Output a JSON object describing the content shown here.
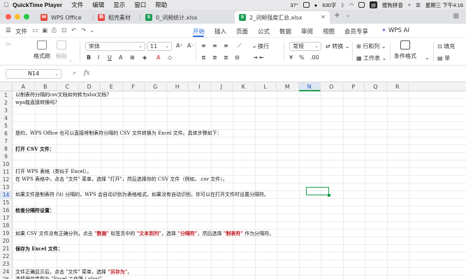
{
  "menubar": {
    "app": "QuickTime Player",
    "items": [
      "文件",
      "编辑",
      "显示",
      "窗口",
      "帮助"
    ],
    "right": {
      "temp": "37°",
      "percent": "630字",
      "ime": "搜狗拼音",
      "datetime": "星期三 下午4:16"
    }
  },
  "tabs": [
    {
      "label": "WPS Office",
      "icon": "wps-logo-icon",
      "color": "#e04b3c"
    },
    {
      "label": "稻壳素材",
      "icon": "docer-icon",
      "color": "#e8433a"
    },
    {
      "label": "0_词频统计.xlsx",
      "icon": "sheet-icon",
      "color": "#1e9e57"
    },
    {
      "label": "2_词频强度汇总.xlsx",
      "icon": "sheet-icon",
      "color": "#1e9e57"
    }
  ],
  "ribbon": {
    "file": "文件",
    "tabs": [
      "开始",
      "插入",
      "页面",
      "公式",
      "数据",
      "审阅",
      "视图",
      "会员专享"
    ],
    "active": "开始",
    "ai": "WPS AI"
  },
  "toolbar": {
    "format_painter": "格式刷",
    "paste": "粘贴",
    "font": "宋体",
    "font_size": "11",
    "wrap": "换行",
    "number_format": "常规",
    "convert": "转换",
    "rows_cols": "行和列",
    "worksheet": "工作表",
    "cond_format": "条件格式",
    "fill": "填充",
    "cell": "单"
  },
  "formula": {
    "cellref": "N14",
    "fx": "fx",
    "value": ""
  },
  "columns": [
    "A",
    "B",
    "C",
    "D",
    "E",
    "F",
    "G",
    "H",
    "I",
    "J",
    "K",
    "L",
    "M",
    "N",
    "O",
    "P",
    "Q",
    "R"
  ],
  "selected_column": "N",
  "selected_row": "14",
  "rows": [
    {
      "n": "1",
      "text": "以制表符分隔的csv文档如何转为xlsx文档?"
    },
    {
      "n": "2",
      "text": "wps能直接转换吗?"
    },
    {
      "n": "3",
      "text": ""
    },
    {
      "n": "4",
      "text": ""
    },
    {
      "n": "5",
      "text": ""
    },
    {
      "n": "6",
      "text": "是的，WPS Office 也可以直接将制表符分隔的 CSV 文件转换为 Excel 文件。具体步骤如下："
    },
    {
      "n": "7",
      "text": ""
    },
    {
      "n": "8",
      "text": "打开 CSV 文件：",
      "bold": true
    },
    {
      "n": "9",
      "text": ""
    },
    {
      "n": "10",
      "text": ""
    },
    {
      "n": "11",
      "text": "    打开 WPS 表格（类似于 Excel）。"
    },
    {
      "n": "12",
      "text": "    在 WPS 表格中，点击 \"文件\" 菜单，选择 \"打开\"，然后选择你的 CSV 文件（例如，.csv 文件）。"
    },
    {
      "n": "13",
      "text": ""
    },
    {
      "n": "14",
      "text": "    如果文件是制表符 (\\t) 分隔的，WPS 会自动识别为表格格式。如果没有自动识别，你可以在打开文件时设置分隔符。"
    },
    {
      "n": "15",
      "text": ""
    },
    {
      "n": "16",
      "text": "检查分隔符设置：",
      "bold": true
    },
    {
      "n": "17",
      "text": ""
    },
    {
      "n": "18",
      "text": ""
    },
    {
      "n": "19",
      "parts": [
        {
          "t": "    如果 CSV 文件没有正确分列，点击 "
        },
        {
          "t": "\"数据\"",
          "red": true
        },
        {
          "t": " 标签页中的 "
        },
        {
          "t": "\"文本到列\"",
          "red": true
        },
        {
          "t": "，选择 "
        },
        {
          "t": "\"分隔符\"",
          "red": true
        },
        {
          "t": "，然后选择 "
        },
        {
          "t": "\"制表符\"",
          "red": true
        },
        {
          "t": " 作为分隔符。"
        }
      ]
    },
    {
      "n": "20",
      "text": ""
    },
    {
      "n": "21",
      "text": "保存为 Excel 文件：",
      "bold": true
    },
    {
      "n": "22",
      "text": ""
    },
    {
      "n": "23",
      "text": ""
    },
    {
      "n": "24",
      "parts": [
        {
          "t": "    文件正确显示后，点击 \"文件\" 菜单，选择 "
        },
        {
          "t": "\"另存为\"",
          "red": true
        },
        {
          "t": "。"
        }
      ]
    },
    {
      "n": "25",
      "text": "    选择保存类型为 \"Excel 工作簿 (.xlsx)\" 。"
    }
  ]
}
